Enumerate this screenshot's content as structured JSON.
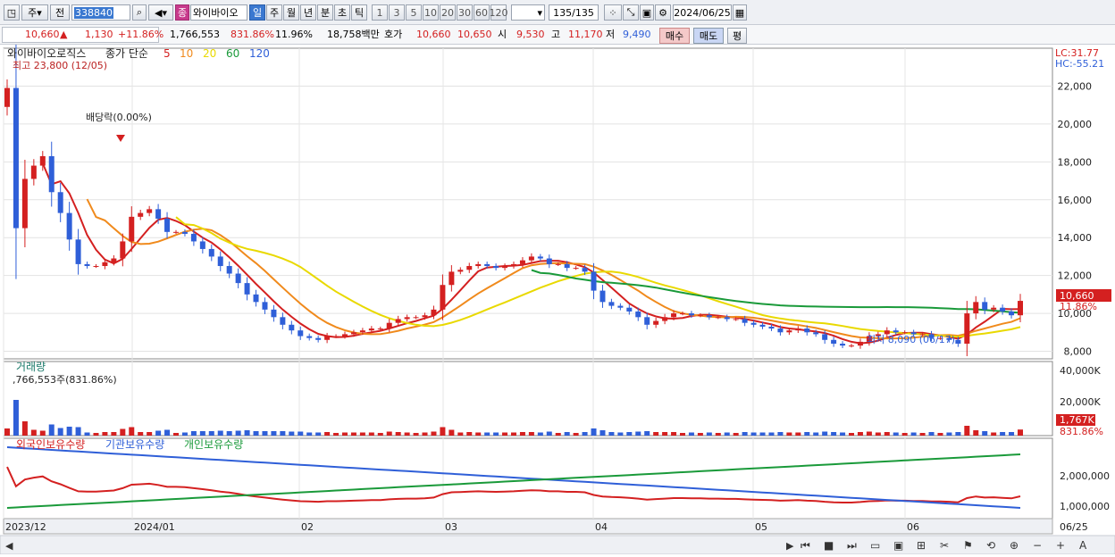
{
  "toolbar": {
    "period_daily": "주",
    "prev_label": "전",
    "stock_code": "338840",
    "badge": "종",
    "stock_name": "와이바이오",
    "periods": [
      "일",
      "주",
      "월",
      "년",
      "분",
      "초",
      "틱"
    ],
    "intervals": [
      "1",
      "3",
      "5",
      "10",
      "20",
      "30",
      "60",
      "120"
    ],
    "count": "135",
    "count_total": "/135",
    "date": "2024/06/25"
  },
  "quote": {
    "price": "10,660",
    "change_arrow": "▲",
    "change": "1,130",
    "change_pct": "+11.86%",
    "volume": "1,766,553",
    "volume_pct": "831.86%",
    "turnover": "11.96%",
    "amount": "18,758백만",
    "hoga_label": "호가",
    "hoga1": "10,660",
    "hoga2": "10,650",
    "open_label": "시",
    "open": "9,530",
    "high_label": "고",
    "high": "11,170",
    "low_label": "저",
    "low": "9,490",
    "buy": "매수",
    "sell": "매도",
    "eval": "평"
  },
  "chart": {
    "title": "와이바이오로직스",
    "ma_label": "종가 단순",
    "ma_periods": [
      {
        "label": "5",
        "color": "#d42020"
      },
      {
        "label": "10",
        "color": "#f08a1c"
      },
      {
        "label": "20",
        "color": "#e9d900"
      },
      {
        "label": "60",
        "color": "#1a9a3a"
      },
      {
        "label": "120",
        "color": "#2f5fd8"
      }
    ],
    "high_note": "최고 23,800 (12/05)",
    "low_note": "최저 8,090 (06/17)",
    "event_note": "배당락(0.00%)",
    "lc": "LC:31.77",
    "hc": "HC:-55.21",
    "y_ticks": [
      "22,000",
      "20,000",
      "18,000",
      "16,000",
      "14,000",
      "12,000",
      "10,000",
      "8,000"
    ],
    "price_tag": "10,660",
    "pct_tag": "11.86%",
    "volume_title": "거래량",
    "volume_note": ",766,553주(831.86%)",
    "volume_ticks": [
      "40,000K",
      "20,000K"
    ],
    "volume_tag": "1,767K",
    "volume_pct_tag": "831.86%",
    "holdings": [
      {
        "label": "외국인보유수량",
        "color": "#d42020"
      },
      {
        "label": "기관보유수량",
        "color": "#2f5fd8"
      },
      {
        "label": "개인보유수량",
        "color": "#1a9a3a"
      }
    ],
    "holdings_ticks": [
      "2,000,000",
      "1,000,000"
    ],
    "x_labels": [
      "2023/12",
      "2024/01",
      "02",
      "03",
      "04",
      "05",
      "06"
    ],
    "x_end": "06/25"
  },
  "colors": {
    "up": "#d42020",
    "down": "#2f5fd8"
  },
  "chart_data": {
    "type": "candlestick",
    "ylim": [
      7600,
      24000
    ],
    "high": {
      "value": 23800,
      "date": "12/05"
    },
    "low": {
      "value": 8090,
      "date": "06/17"
    },
    "last": {
      "open": 9530,
      "high": 11170,
      "low": 9490,
      "close": 10660
    },
    "closes": [
      21900,
      14500,
      17100,
      17800,
      18300,
      16400,
      15300,
      13900,
      12600,
      12500,
      12500,
      12700,
      12900,
      13800,
      15100,
      15300,
      15500,
      15000,
      14300,
      14300,
      14200,
      13800,
      13400,
      13000,
      12500,
      12100,
      11600,
      11000,
      10600,
      10200,
      9800,
      9400,
      9100,
      8800,
      8700,
      8600,
      8800,
      8800,
      8900,
      9000,
      9100,
      9200,
      9200,
      9500,
      9700,
      9800,
      9800,
      9900,
      10200,
      11500,
      12200,
      12300,
      12500,
      12600,
      12500,
      12400,
      12500,
      12600,
      12800,
      13000,
      12900,
      12600,
      12600,
      12400,
      12400,
      12200,
      11200,
      10600,
      10400,
      10300,
      10100,
      9800,
      9400,
      9600,
      9800,
      10000,
      10000,
      9900,
      9900,
      9800,
      9800,
      9700,
      9700,
      9500,
      9400,
      9300,
      9200,
      9000,
      9100,
      9200,
      9000,
      8900,
      8600,
      8400,
      8300,
      8300,
      8500,
      8800,
      8900,
      9100,
      9000,
      9000,
      8900,
      8900,
      8700,
      8700,
      8600,
      8400,
      10000,
      10600,
      10200,
      10300,
      10100,
      9900,
      10660
    ]
  }
}
